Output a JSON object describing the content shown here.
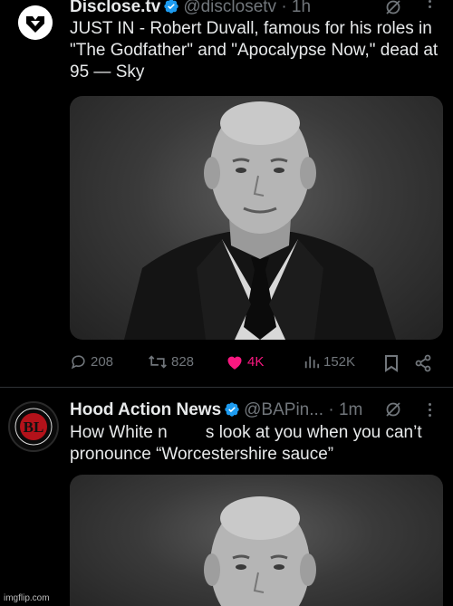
{
  "tweet1": {
    "author_name": "Disclose.tv",
    "author_handle": "@disclosetv",
    "time": "· 1h",
    "text": "JUST IN -  Robert Duvall, famous for his roles in \"The Godfather\" and \"Apocalypse Now,\" dead at 95 — Sky",
    "replies": "208",
    "reposts": "828",
    "likes": "4K",
    "views": "152K",
    "like_color": "#f91880"
  },
  "tweet2": {
    "author_name": "Hood Action News",
    "author_handle": "@BAPin...",
    "time": "· 1m",
    "text": "How White n        s look at you when you can’t pronounce “Worcestershire sauce”",
    "avatar_letters": "BL"
  },
  "colors": {
    "verified": "#1d9bf0",
    "muted": "#71767b"
  },
  "watermark": "imgflip.com"
}
